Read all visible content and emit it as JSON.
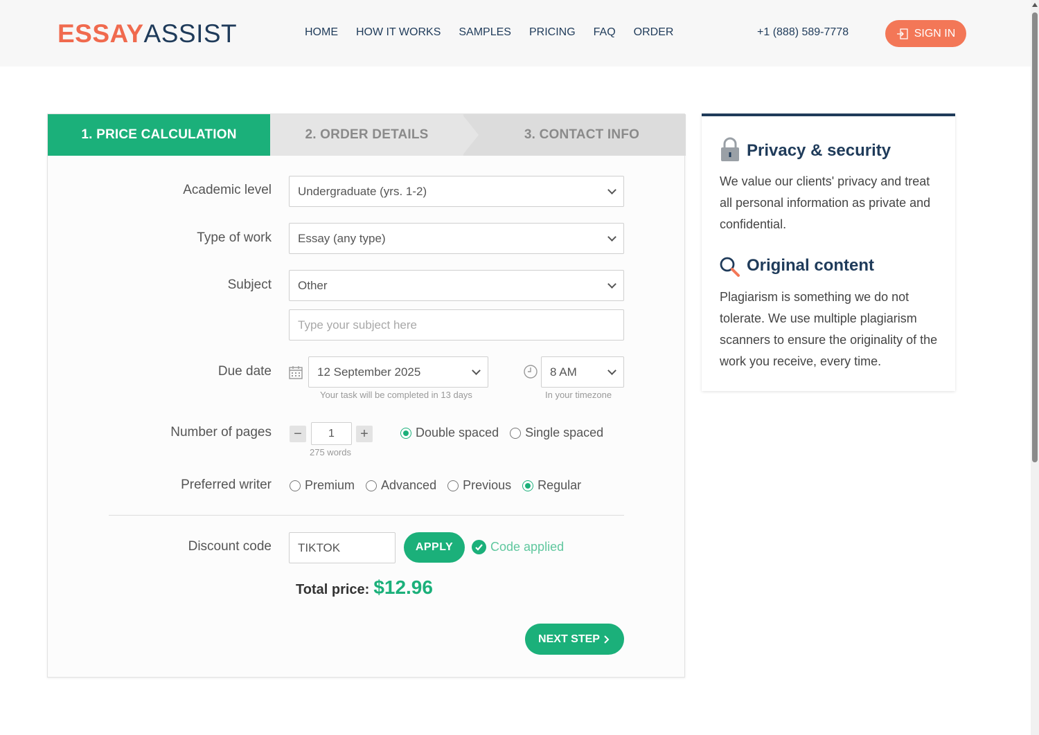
{
  "header": {
    "logo_part1": "ESSAY",
    "logo_part2": "ASSIST",
    "nav": [
      "HOME",
      "HOW IT WORKS",
      "SAMPLES",
      "PRICING",
      "FAQ",
      "ORDER"
    ],
    "phone": "+1 (888) 589-7778",
    "signin_label": "SIGN IN"
  },
  "steps": {
    "step1": "1. PRICE CALCULATION",
    "step2": "2. ORDER DETAILS",
    "step3": "3. CONTACT INFO"
  },
  "form": {
    "academic_label": "Academic level",
    "academic_value": "Undergraduate (yrs. 1-2)",
    "type_label": "Type of work",
    "type_value": "Essay (any type)",
    "subject_label": "Subject",
    "subject_value": "Other",
    "subject_placeholder": "Type your subject here",
    "due_label": "Due date",
    "due_date_value": "12 September 2025",
    "due_hint": "Your task will be completed in 13 days",
    "time_value": "8 AM",
    "time_hint": "In your timezone",
    "pages_label": "Number of pages",
    "pages_value": "1",
    "pages_minus": "−",
    "pages_plus": "+",
    "words_hint": "275 words",
    "spacing_options": [
      "Double spaced",
      "Single spaced"
    ],
    "spacing_selected": "Double spaced",
    "writer_label": "Preferred writer",
    "writer_options": [
      "Premium",
      "Advanced",
      "Previous",
      "Regular"
    ],
    "writer_selected": "Regular",
    "discount_label": "Discount code",
    "discount_value": "TIKTOK",
    "apply_label": "APPLY",
    "applied_text": "Code applied",
    "total_label": "Total price:",
    "total_value": "$12.96",
    "next_label": "NEXT STEP"
  },
  "side": {
    "privacy_title": "Privacy & security",
    "privacy_text": "We value our clients' privacy and treat all personal information as private and confidential.",
    "original_title": "Original content",
    "original_text": "Plagiarism is something we do not tolerate. We use multiple plagiarism scanners to ensure the originality of the work you receive, every time."
  },
  "icons": {
    "signin": "sign-in-icon",
    "calendar": "calendar-icon",
    "clock": "clock-icon",
    "lock": "lock-icon",
    "search": "search-icon",
    "check": "check-icon",
    "chevron": "chevron-down-icon",
    "next_chevron": "chevron-right-icon"
  },
  "colors": {
    "green": "#1bb07a",
    "navy": "#1f3b5a",
    "orange": "#f37757"
  }
}
